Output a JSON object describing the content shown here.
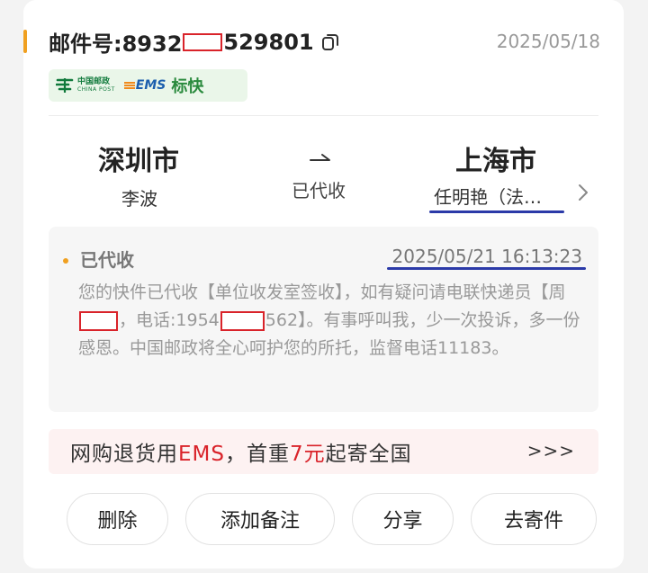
{
  "header": {
    "mail_prefix": "邮件号:8932",
    "mail_suffix": "529801",
    "date": "2025/05/18"
  },
  "brand": {
    "china_post_zh": "中国邮政",
    "china_post_en": "CHINA POST",
    "ems_mark": "EMS",
    "service": "标快"
  },
  "route": {
    "from_city": "深圳市",
    "from_person": "李波",
    "status": "已代收",
    "to_city": "上海市",
    "to_person": "任明艳（法…"
  },
  "tracking": {
    "status": "已代收",
    "time": "2025/05/21 16:13:23",
    "desc_part1": "您的快件已代收【单位收发室签收】，如有疑问请电联快递员【周",
    "desc_part2": "，电话:1954",
    "desc_part3": "562】。有事呼叫我，少一次投诉，多一份感恩。中国邮政将全心呵护您的所托，监督电话11183。"
  },
  "promo": {
    "text_a": "网购退货用",
    "text_b": "EMS",
    "text_c": "，首重",
    "text_d": "7元",
    "text_e": "起寄全国",
    "more": ">>>"
  },
  "actions": {
    "delete": "删除",
    "add_note": "添加备注",
    "share": "分享",
    "send": "去寄件"
  },
  "colors": {
    "accent": "#f0a020",
    "brand_red": "#d9232a",
    "annotation_blue": "#2b3aa8",
    "post_green": "#117a3c"
  }
}
